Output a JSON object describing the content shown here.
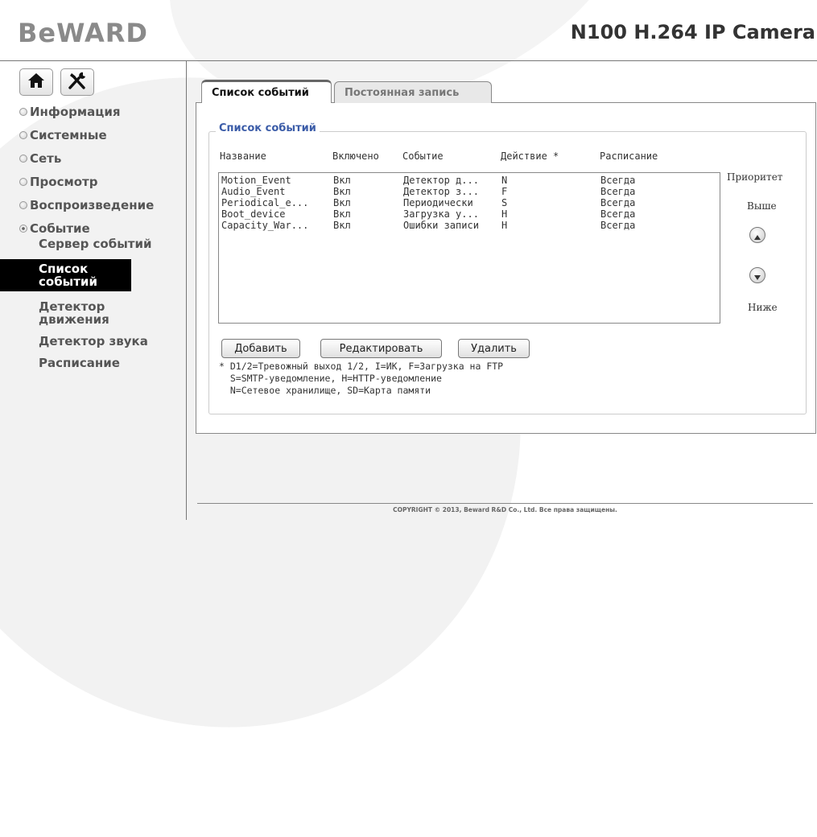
{
  "brand": {
    "logo": "BeWARD",
    "model": "N100 H.264 IP Camera"
  },
  "toolbar": {
    "home_icon": "home-icon",
    "settings_icon": "tools-icon"
  },
  "nav": {
    "items": [
      {
        "label": "Информация",
        "state": "collapsed"
      },
      {
        "label": "Системные",
        "state": "collapsed"
      },
      {
        "label": "Сеть",
        "state": "collapsed"
      },
      {
        "label": "Просмотр",
        "state": "collapsed"
      },
      {
        "label": "Воспроизведение",
        "state": "collapsed"
      },
      {
        "label": "Событие",
        "state": "expanded"
      }
    ],
    "sub_items": [
      {
        "label": "Сервер событий"
      },
      {
        "label": "Список событий",
        "active": true
      },
      {
        "label": "Детектор движения"
      },
      {
        "label": "Детектор звука"
      },
      {
        "label": "Расписание"
      }
    ]
  },
  "tabs": [
    {
      "label": "Список событий",
      "active": true
    },
    {
      "label": "Постоянная запись",
      "active": false
    }
  ],
  "events": {
    "legend": "Список событий",
    "columns": [
      "Название",
      "Включено",
      "Событие",
      "Действие *",
      "Расписание"
    ],
    "rows": [
      [
        "Motion_Event",
        "Вкл",
        "Детектор д...",
        "N",
        "Всегда"
      ],
      [
        "Audio_Event",
        "Вкл",
        "Детектор з...",
        "F",
        "Всегда"
      ],
      [
        "Periodical_e...",
        "Вкл",
        "Периодически",
        "S",
        "Всегда"
      ],
      [
        "Boot_device",
        "Вкл",
        "Загрузка у...",
        "H",
        "Всегда"
      ],
      [
        "Capacity_War...",
        "Вкл",
        "Ошибки записи",
        "H",
        "Всегда"
      ]
    ],
    "priority": {
      "label": "Приоритет",
      "higher": "Выше",
      "lower": "Ниже"
    },
    "buttons": {
      "add": "Добавить",
      "edit": "Редактировать",
      "delete": "Удалить"
    },
    "note": [
      "* D1/2=Тревожный выход 1/2, I=ИК, F=Загрузка на FTP",
      "  S=SMTP-уведомление, H=HTTP-уведомление",
      "  N=Сетевое хранилище, SD=Карта памяти"
    ]
  },
  "footer": {
    "copyright": "COPYRIGHT © 2013, Beward R&D Co., Ltd. Все права защищены."
  }
}
